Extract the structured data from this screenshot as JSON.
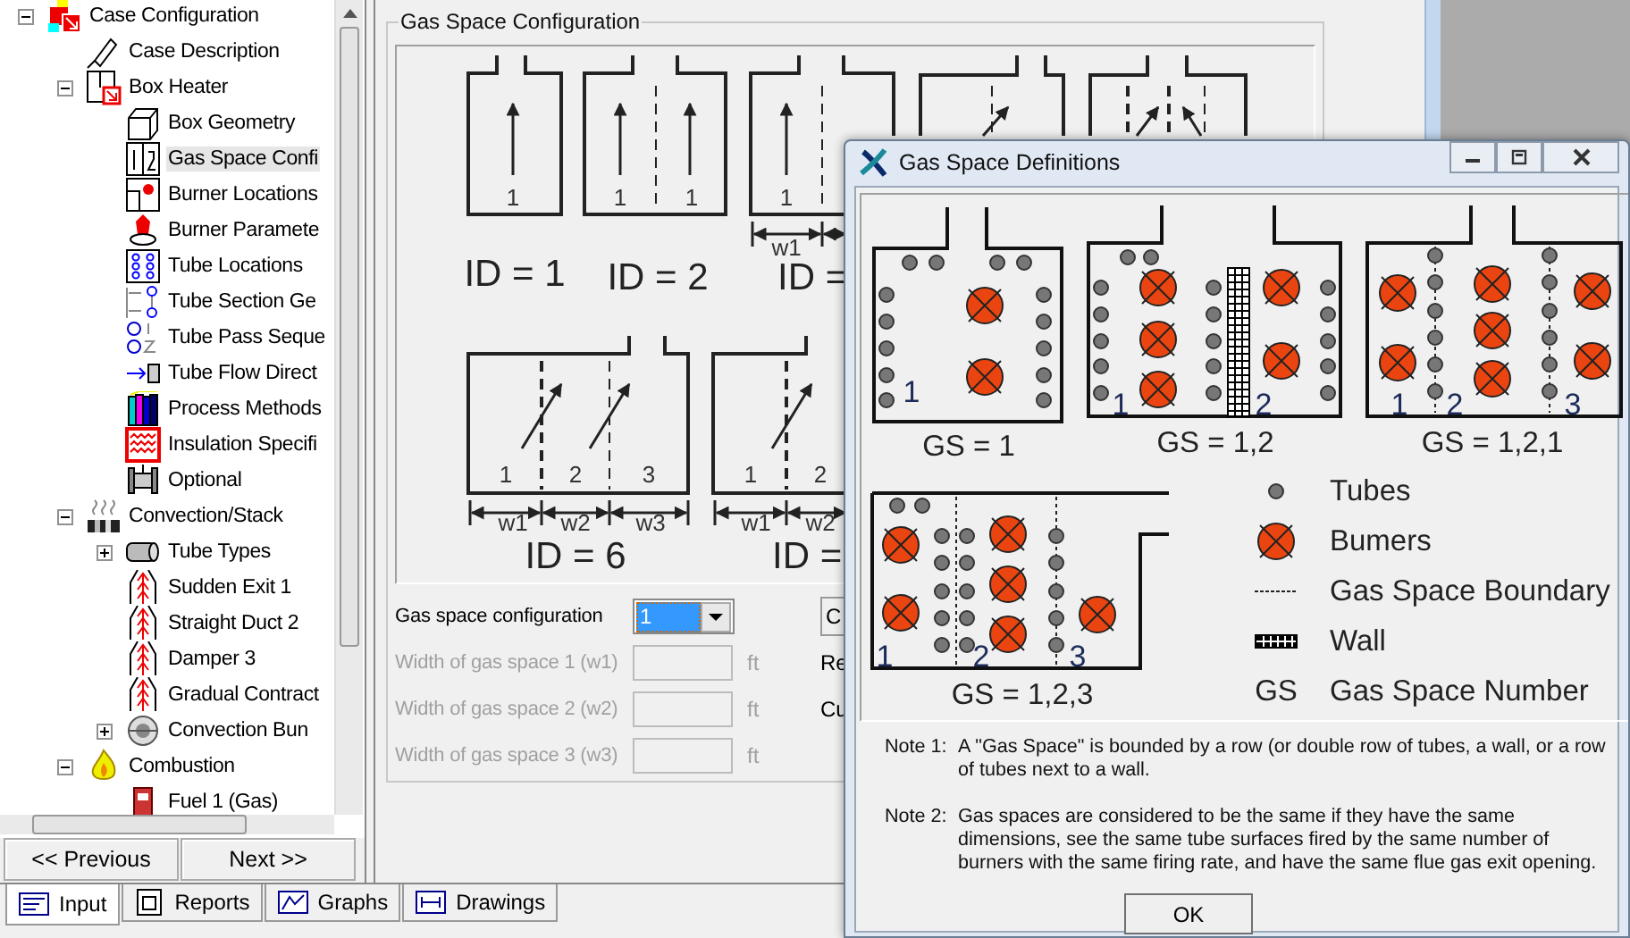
{
  "tree": {
    "items": [
      {
        "label": "Case Configuration",
        "expanded": true,
        "selected": false,
        "children": [
          {
            "label": "Case Description",
            "selected": false
          },
          {
            "label": "Box Heater",
            "expanded": true,
            "selected": false,
            "children": [
              {
                "label": "Box Geometry",
                "selected": false
              },
              {
                "label": "Gas Space Confi",
                "selected": true
              },
              {
                "label": "Burner Locations",
                "selected": false
              },
              {
                "label": "Burner Paramete",
                "selected": false
              },
              {
                "label": "Tube Locations",
                "selected": false
              },
              {
                "label": "Tube Section Ge",
                "selected": false
              },
              {
                "label": "Tube Pass Seque",
                "selected": false
              },
              {
                "label": "Tube Flow Direct",
                "selected": false
              },
              {
                "label": "Process Methods",
                "selected": false
              },
              {
                "label": "Insulation Specifi",
                "selected": false
              },
              {
                "label": "Optional",
                "selected": false
              }
            ]
          },
          {
            "label": "Convection/Stack",
            "expanded": true,
            "selected": false,
            "children": [
              {
                "label": "Tube Types",
                "expanded": false,
                "selected": false
              },
              {
                "label": "Sudden Exit 1",
                "selected": false
              },
              {
                "label": "Straight Duct 2",
                "selected": false
              },
              {
                "label": "Damper 3",
                "selected": false
              },
              {
                "label": "Gradual Contract",
                "selected": false
              },
              {
                "label": "Convection Bun",
                "expanded": false,
                "selected": false
              }
            ]
          },
          {
            "label": "Combustion",
            "expanded": true,
            "selected": false,
            "children": [
              {
                "label": "Fuel 1 (Gas)",
                "selected": false
              }
            ]
          }
        ]
      }
    ]
  },
  "nav_buttons": [
    "<< Previous",
    "Next >>"
  ],
  "bottom_tabs": [
    {
      "label": "Input",
      "selected": true
    },
    {
      "label": "Reports",
      "selected": false
    },
    {
      "label": "Graphs",
      "selected": false
    },
    {
      "label": "Drawings",
      "selected": false
    }
  ],
  "config_panel": {
    "title": "Gas Space Configuration",
    "configurations": [
      {
        "id_label": "ID = 1",
        "zones": [
          "1"
        ]
      },
      {
        "id_label": "ID = 2",
        "zones": [
          "1",
          "1"
        ]
      },
      {
        "id_label": "ID =",
        "zones": [
          "1"
        ],
        "widths": [
          "w1"
        ]
      },
      {
        "id_label": "ID = 6",
        "zones": [
          "1",
          "2",
          "3"
        ],
        "widths": [
          "w1",
          "w2",
          "w3"
        ]
      },
      {
        "id_label": "ID =",
        "zones": [
          "1",
          "2"
        ],
        "widths": [
          "w1",
          "w2"
        ]
      }
    ],
    "selector": {
      "label": "Gas space configuration",
      "value": "1"
    },
    "fields": [
      {
        "label": "Width of gas space 1 (w1)",
        "unit": "ft",
        "disabled": true
      },
      {
        "label": "Width of gas space 2 (w2)",
        "unit": "ft",
        "disabled": true
      },
      {
        "label": "Width of gas space 3 (w3)",
        "unit": "ft",
        "disabled": true
      }
    ],
    "button": "C",
    "side_labels": [
      "Re",
      "Cu"
    ]
  },
  "dialog": {
    "title": "Gas Space Definitions",
    "examples": [
      {
        "label": "GS = 1",
        "zones": [
          "1"
        ]
      },
      {
        "label": "GS = 1,2",
        "zones": [
          "1",
          "2"
        ]
      },
      {
        "label": "GS = 1,2,1",
        "zones": [
          "1",
          "2",
          "3"
        ]
      },
      {
        "label": "GS = 1,2,3",
        "zones": [
          "1",
          "2",
          "3"
        ]
      }
    ],
    "legend": [
      {
        "kind": "tube",
        "label": "Tubes"
      },
      {
        "kind": "burner",
        "label": "Bumers"
      },
      {
        "kind": "boundary",
        "label": "Gas Space Boundary"
      },
      {
        "kind": "wall",
        "label": "Wall"
      },
      {
        "kind": "symbol",
        "symbol": "GS",
        "label": "Gas Space Number"
      }
    ],
    "notes": [
      {
        "label": "Note 1:",
        "text": "A \"Gas Space\" is bounded by a row (or double row of tubes, a wall, or a row of tubes next to a wall."
      },
      {
        "label": "Note 2:",
        "text": "Gas spaces are considered to be the same if they have the same dimensions, see the same tube surfaces fired by the same number of burners with the same firing rate, and have the same flue gas exit opening."
      }
    ],
    "ok_button": "OK"
  }
}
